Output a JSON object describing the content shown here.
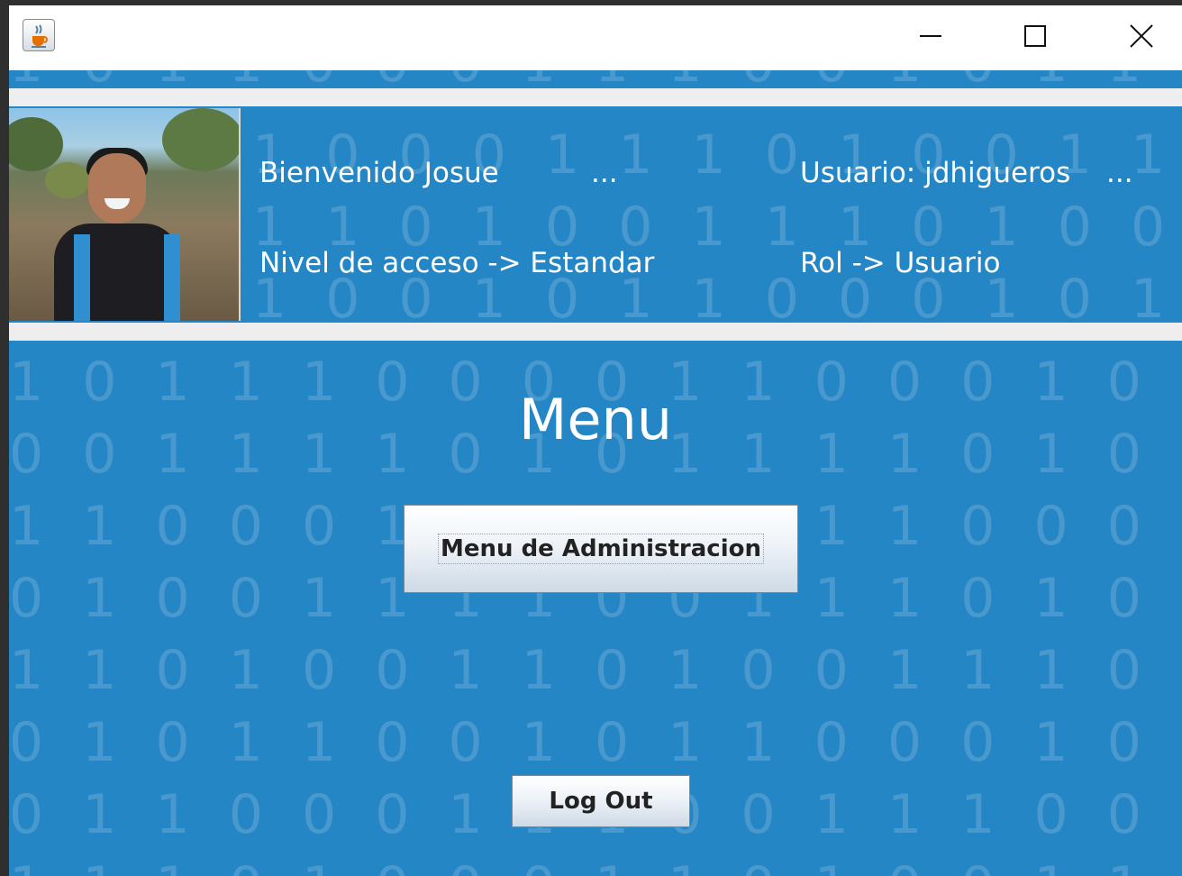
{
  "window": {
    "app_icon": "java-cup-icon",
    "controls": [
      "minimize-icon",
      "maximize-icon",
      "close-icon"
    ]
  },
  "header": {
    "welcome": "Bienvenido Josue",
    "welcome_ellipsis": "...",
    "user": "Usuario: jdhigueros",
    "user_ellipsis": "...",
    "access_level": "Nivel de acceso -> Estandar",
    "role": "Rol -> Usuario",
    "photo": "profile-photo"
  },
  "main": {
    "title": "Menu",
    "admin_button": "Menu de Administracion",
    "logout_button": "Log Out"
  },
  "colors": {
    "panel_blue": "#2486c5",
    "separator": "#eeeeee",
    "text": "#ffffff"
  }
}
